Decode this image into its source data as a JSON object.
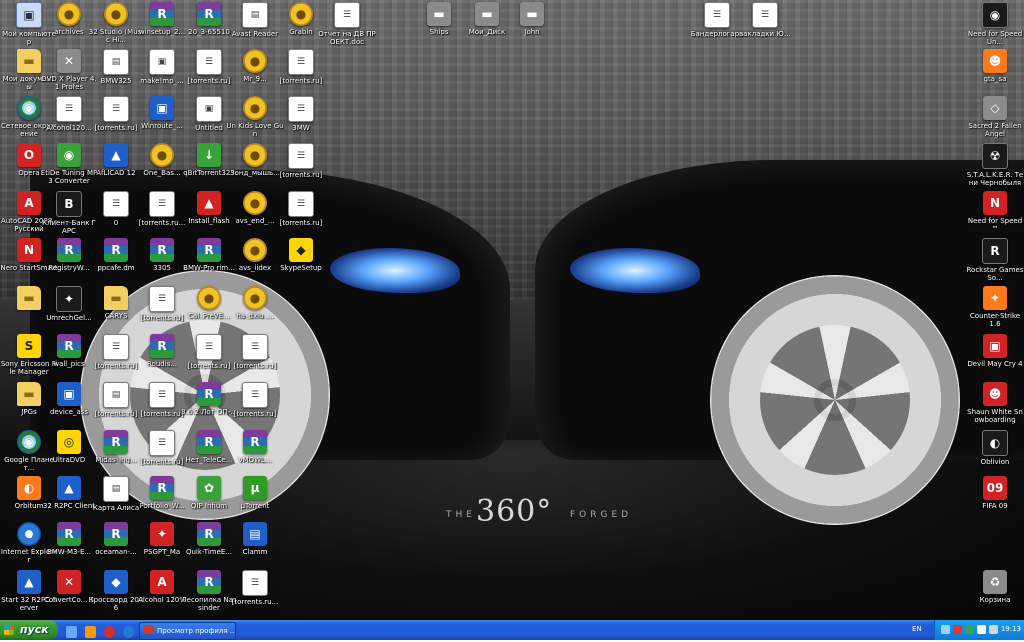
{
  "wallpaper": {
    "logo_big": "360°",
    "logo_pre": "THE",
    "logo_brand": "FORGED"
  },
  "icons": [
    {
      "id": "ic-01",
      "label": "Мой компьютер",
      "glyph": "▣",
      "style": "i-comp"
    },
    {
      "id": "ic-02",
      "label": "Мои документы",
      "glyph": "▬",
      "style": "i-folder"
    },
    {
      "id": "ic-03",
      "label": "Сетевое окружение",
      "glyph": "◉",
      "style": "i-globe"
    },
    {
      "id": "ic-04",
      "label": "Opera",
      "glyph": "O",
      "style": "i-red"
    },
    {
      "id": "ic-05",
      "label": "AutoCAD 2008 - Русский",
      "glyph": "A",
      "style": "i-red"
    },
    {
      "id": "ic-06",
      "label": "Nero StartSmart",
      "glyph": "N",
      "style": "i-red"
    },
    {
      "id": "ic-07",
      "label": "",
      "glyph": "▬",
      "style": "i-folder"
    },
    {
      "id": "ic-08",
      "label": "Sony Ericsson File Manager",
      "glyph": "S",
      "style": "i-yellow"
    },
    {
      "id": "ic-09",
      "label": "JPGs",
      "glyph": "▬",
      "style": "i-folder"
    },
    {
      "id": "ic-10",
      "label": "Google Планет...",
      "glyph": "◉",
      "style": "i-globe"
    },
    {
      "id": "ic-11",
      "label": "Orbitum",
      "glyph": "◐",
      "style": "i-orange"
    },
    {
      "id": "ic-12",
      "label": "Internet Explorer",
      "glyph": "e",
      "style": "i-ie"
    },
    {
      "id": "ic-13",
      "label": "Start 32 R2PC Server",
      "glyph": "▲",
      "style": "i-blue"
    },
    {
      "id": "ic-14",
      "label": "archives",
      "glyph": "●",
      "style": "i-disk"
    },
    {
      "id": "ic-15",
      "label": "DVD X Player 4.1 Profes",
      "glyph": "✕",
      "style": "i-gray"
    },
    {
      "id": "ic-16",
      "label": "Alcohol120...",
      "glyph": "☰",
      "style": "i-doc"
    },
    {
      "id": "ic-17",
      "label": "EtiDe Tuning MP3 Converter",
      "glyph": "◉",
      "style": "i-green"
    },
    {
      "id": "ic-18",
      "label": "Клиент-Банк ГАРС",
      "glyph": "B",
      "style": "i-black"
    },
    {
      "id": "ic-19",
      "label": "RegistryW...",
      "glyph": "R",
      "style": "i-rar"
    },
    {
      "id": "ic-20",
      "label": "UmrechGel...",
      "glyph": "✦",
      "style": "i-black"
    },
    {
      "id": "ic-21",
      "label": "wall_pics",
      "glyph": "R",
      "style": "i-rar"
    },
    {
      "id": "ic-22",
      "label": "device_ass",
      "glyph": "▣",
      "style": "i-blue"
    },
    {
      "id": "ic-23",
      "label": "UltraDVD",
      "glyph": "◎",
      "style": "i-yellow"
    },
    {
      "id": "ic-24",
      "label": "32 R2PC Client",
      "glyph": "▲",
      "style": "i-blue"
    },
    {
      "id": "ic-25",
      "label": "BMW-M3-E...",
      "glyph": "R",
      "style": "i-rar"
    },
    {
      "id": "ic-26",
      "label": "ConvertCo... 3",
      "glyph": "✕",
      "style": "i-red"
    },
    {
      "id": "ic-27",
      "label": "32 Studio (Music Hi...",
      "glyph": "●",
      "style": "i-disk"
    },
    {
      "id": "ic-28",
      "label": "BMW325",
      "glyph": "▤",
      "style": "i-doc"
    },
    {
      "id": "ic-29",
      "label": "[torrents.ru]",
      "glyph": "☰",
      "style": "i-doc"
    },
    {
      "id": "ic-30",
      "label": "AfLICAD 12",
      "glyph": "▲",
      "style": "i-blue"
    },
    {
      "id": "ic-31",
      "label": "0",
      "glyph": "☰",
      "style": "i-doc"
    },
    {
      "id": "ic-32",
      "label": "ppcafe.dm",
      "glyph": "R",
      "style": "i-rar"
    },
    {
      "id": "ic-33",
      "label": "CARYS",
      "glyph": "▬",
      "style": "i-folder"
    },
    {
      "id": "ic-34",
      "label": "[torrents.ru]",
      "glyph": "☰",
      "style": "i-doc"
    },
    {
      "id": "ic-35",
      "label": "[torrents.ru]",
      "glyph": "▤",
      "style": "i-doc"
    },
    {
      "id": "ic-36",
      "label": "Midas_ing...",
      "glyph": "R",
      "style": "i-rar"
    },
    {
      "id": "ic-37",
      "label": "Карта Алиса",
      "glyph": "▤",
      "style": "i-doc"
    },
    {
      "id": "ic-38",
      "label": "oceaman-...",
      "glyph": "R",
      "style": "i-rar"
    },
    {
      "id": "ic-39",
      "label": "Кроссворд 2006",
      "glyph": "◆",
      "style": "i-blue"
    },
    {
      "id": "ic-40",
      "label": "winsetup_2...",
      "glyph": "R",
      "style": "i-rar"
    },
    {
      "id": "ic-41",
      "label": "make!mp_...",
      "glyph": "▣",
      "style": "i-doc"
    },
    {
      "id": "ic-42",
      "label": "Winroute_...",
      "glyph": "▣",
      "style": "i-blue"
    },
    {
      "id": "ic-43",
      "label": "One_Bas...",
      "glyph": "●",
      "style": "i-disk"
    },
    {
      "id": "ic-44",
      "label": "[torrents.ru...",
      "glyph": "☰",
      "style": "i-doc"
    },
    {
      "id": "ic-45",
      "label": "3305",
      "glyph": "R",
      "style": "i-rar"
    },
    {
      "id": "ic-46",
      "label": "[torrents.ru]",
      "glyph": "☰",
      "style": "i-doc"
    },
    {
      "id": "ic-47",
      "label": "Roudis...",
      "glyph": "R",
      "style": "i-rar"
    },
    {
      "id": "ic-48",
      "label": "[torrents.ru]",
      "glyph": "☰",
      "style": "i-doc"
    },
    {
      "id": "ic-49",
      "label": "[torrents.ru]",
      "glyph": "☰",
      "style": "i-doc"
    },
    {
      "id": "ic-50",
      "label": "Portfolio_W...",
      "glyph": "R",
      "style": "i-rar"
    },
    {
      "id": "ic-51",
      "label": "PSGPT_Ma",
      "glyph": "✦",
      "style": "i-red"
    },
    {
      "id": "ic-52",
      "label": "Alcohol 120%",
      "glyph": "A",
      "style": "i-red"
    },
    {
      "id": "ic-53",
      "label": "20_3-65510",
      "glyph": "R",
      "style": "i-rar"
    },
    {
      "id": "ic-54",
      "label": "[torrents.ru]",
      "glyph": "☰",
      "style": "i-doc"
    },
    {
      "id": "ic-55",
      "label": "Untitled",
      "glyph": "▣",
      "style": "i-doc"
    },
    {
      "id": "ic-56",
      "label": "qBitTorrent32S",
      "glyph": "↓",
      "style": "i-green"
    },
    {
      "id": "ic-57",
      "label": "Install_flash",
      "glyph": "▲",
      "style": "i-red"
    },
    {
      "id": "ic-58",
      "label": "BMW-Pro rim...",
      "glyph": "R",
      "style": "i-rar"
    },
    {
      "id": "ic-59",
      "label": "Cal_PreVE...",
      "glyph": "●",
      "style": "i-disk"
    },
    {
      "id": "ic-60",
      "label": "[torrents.ru]",
      "glyph": "☰",
      "style": "i-doc"
    },
    {
      "id": "ic-61",
      "label": "3.6.2 Лот ОП-...",
      "glyph": "R",
      "style": "i-rar"
    },
    {
      "id": "ic-62",
      "label": "Нет_TeleCe...",
      "glyph": "R",
      "style": "i-rar"
    },
    {
      "id": "ic-63",
      "label": "QIP Infium",
      "glyph": "✿",
      "style": "i-green"
    },
    {
      "id": "ic-64",
      "label": "Quik-TimeE...",
      "glyph": "R",
      "style": "i-rar"
    },
    {
      "id": "ic-65",
      "label": "Лесопилка Nassinder",
      "glyph": "R",
      "style": "i-rar"
    },
    {
      "id": "ic-66",
      "label": "Avast Reader",
      "glyph": "▤",
      "style": "i-doc"
    },
    {
      "id": "ic-67",
      "label": "Mr_9...",
      "glyph": "●",
      "style": "i-disk"
    },
    {
      "id": "ic-68",
      "label": "Un Kids Love Gun",
      "glyph": "●",
      "style": "i-disk"
    },
    {
      "id": "ic-69",
      "label": "Зонд_мышь...",
      "glyph": "●",
      "style": "i-disk"
    },
    {
      "id": "ic-70",
      "label": "avs_end_...",
      "glyph": "●",
      "style": "i-disk"
    },
    {
      "id": "ic-71",
      "label": "avs_iidex",
      "glyph": "●",
      "style": "i-disk"
    },
    {
      "id": "ic-72",
      "label": "ha_dxiu_...",
      "glyph": "●",
      "style": "i-disk"
    },
    {
      "id": "ic-73",
      "label": "[torrents.ru]",
      "glyph": "☰",
      "style": "i-doc"
    },
    {
      "id": "ic-74",
      "label": "[torrents.ru]",
      "glyph": "☰",
      "style": "i-doc"
    },
    {
      "id": "ic-75",
      "label": "vMOWL...",
      "glyph": "R",
      "style": "i-rar"
    },
    {
      "id": "ic-76",
      "label": "µTorrent",
      "glyph": "µ",
      "style": "i-utor"
    },
    {
      "id": "ic-77",
      "label": "Clamm",
      "glyph": "▤",
      "style": "i-blue"
    },
    {
      "id": "ic-78",
      "label": "[torrents.ru...",
      "glyph": "☰",
      "style": "i-doc"
    },
    {
      "id": "ic-79",
      "label": "Grabin",
      "glyph": "●",
      "style": "i-disk"
    },
    {
      "id": "ic-80",
      "label": "[torrents.ru]",
      "glyph": "☰",
      "style": "i-doc"
    },
    {
      "id": "ic-81",
      "label": "3MW",
      "glyph": "☰",
      "style": "i-doc"
    },
    {
      "id": "ic-82",
      "label": "[torrents.ru]",
      "glyph": "☰",
      "style": "i-doc"
    },
    {
      "id": "ic-83",
      "label": "[torrents.ru]",
      "glyph": "☰",
      "style": "i-doc"
    },
    {
      "id": "ic-84",
      "label": "SkypeSetup",
      "glyph": "◆",
      "style": "i-yellow"
    },
    {
      "id": "ic-85",
      "label": "Отчет на ДВ ПРОЕКТ.doc",
      "glyph": "☰",
      "style": "i-doc"
    },
    {
      "id": "ic-86",
      "label": "Ships",
      "glyph": "▬",
      "style": "i-gray"
    },
    {
      "id": "ic-87",
      "label": "Мои_Диск",
      "glyph": "▬",
      "style": "i-gray"
    },
    {
      "id": "ic-88",
      "label": "John",
      "glyph": "▬",
      "style": "i-gray"
    },
    {
      "id": "ic-89",
      "label": "Бандерлогарь",
      "glyph": "☰",
      "style": "i-doc"
    },
    {
      "id": "ic-90",
      "label": "закладки Ю...",
      "glyph": "☰",
      "style": "i-doc"
    },
    {
      "id": "ic-91",
      "label": "Need for Speed Un...",
      "glyph": "◉",
      "style": "i-black"
    },
    {
      "id": "ic-92",
      "label": "gta_sa",
      "glyph": "☻",
      "style": "i-orange"
    },
    {
      "id": "ic-93",
      "label": "Sacred 2 Fallen Angel",
      "glyph": "◇",
      "style": "i-gray"
    },
    {
      "id": "ic-94",
      "label": "S.T.A.L.K.E.R. Тени Чернобыля",
      "glyph": "☢",
      "style": "i-black"
    },
    {
      "id": "ic-95",
      "label": "Need for Speed™",
      "glyph": "N",
      "style": "i-red"
    },
    {
      "id": "ic-96",
      "label": "Rockstar Games So...",
      "glyph": "R",
      "style": "i-black"
    },
    {
      "id": "ic-97",
      "label": "Counter-Strike 1.6",
      "glyph": "✦",
      "style": "i-orange"
    },
    {
      "id": "ic-98",
      "label": "Devil May Cry 4",
      "glyph": "▣",
      "style": "i-red"
    },
    {
      "id": "ic-99",
      "label": "Shaun White Snowboarding",
      "glyph": "☻",
      "style": "i-red"
    },
    {
      "id": "ic-100",
      "label": "Oblivion",
      "glyph": "◐",
      "style": "i-black"
    },
    {
      "id": "ic-101",
      "label": "FIFA 09",
      "glyph": "09",
      "style": "i-red"
    },
    {
      "id": "ic-102",
      "label": "Корзина",
      "glyph": "♻",
      "style": "i-gray"
    }
  ],
  "taskbar": {
    "start_label": "пуск",
    "task_label": "Просмотр профиля ...",
    "lang": "EN",
    "clock": "19:13"
  }
}
